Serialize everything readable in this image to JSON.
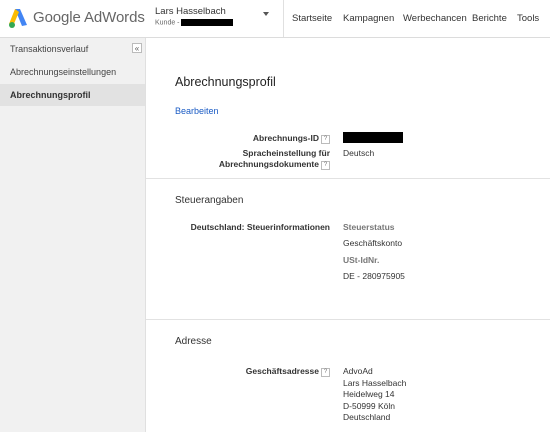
{
  "header": {
    "brand": "Google AdWords",
    "account_name": "Lars Hasselbach",
    "account_id_prefix": "Kunde -",
    "nav": [
      "Startseite",
      "Kampagnen",
      "Werbechancen",
      "Berichte",
      "Tools"
    ]
  },
  "sidebar": {
    "collapse_glyph": "«",
    "items": [
      {
        "label": "Transaktionsverlauf"
      },
      {
        "label": "Abrechnungseinstellungen"
      },
      {
        "label": "Abrechnungsprofil",
        "active": true
      }
    ]
  },
  "main": {
    "title": "Abrechnungsprofil",
    "edit_label": "Bearbeiten",
    "billing_id_label": "Abrechnungs-ID",
    "language_label_line1": "Spracheinstellung für",
    "language_label_line2": "Abrechnungsdokumente",
    "language_value": "Deutsch",
    "tax": {
      "section_title": "Steuerangaben",
      "country_label": "Deutschland: Steuerinformationen",
      "status_label": "Steuerstatus",
      "status_value": "Geschäftskonto",
      "vat_label": "USt-IdNr.",
      "vat_value": "DE - 280975905"
    },
    "address": {
      "section_title": "Adresse",
      "label": "Geschäftsadresse",
      "lines": [
        "AdvoAd",
        "Lars Hasselbach",
        "Heidelweg 14",
        "D-50999 Köln",
        "Deutschland"
      ]
    },
    "help_glyph": "?"
  },
  "colors": {
    "link": "#1a5bc4",
    "logo_blue": "#4285f4",
    "logo_yellow": "#fbbc04",
    "logo_green": "#34a853",
    "redaction": "#000000"
  },
  "icons": [
    "adwords-logo-icon",
    "dropdown-caret-icon",
    "collapse-icon",
    "help-icon"
  ]
}
